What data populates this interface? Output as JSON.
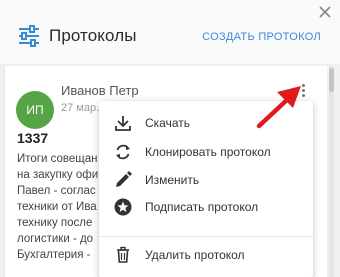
{
  "header": {
    "title": "Протоколы",
    "create_label": "СОЗДАТЬ ПРОТОКОЛ",
    "icons": {
      "menu": "sliders-icon",
      "close": "close-icon"
    }
  },
  "card": {
    "avatar_initials": "ИП",
    "author": "Иванов Петр",
    "date": "27 мар. 2",
    "title": "1337",
    "text_lines": [
      "Итоги совещан",
      "на закупку офи",
      "Павел - соглас",
      "техники от Ива",
      "технику после",
      "логистики - до",
      "Бухгалтерия -"
    ]
  },
  "menu": {
    "items": [
      {
        "label": "Скачать",
        "icon": "download-icon"
      },
      {
        "label": "Клонировать протокол",
        "icon": "clone-icon"
      },
      {
        "label": "Изменить",
        "icon": "edit-icon"
      },
      {
        "label": "Подписать протокол",
        "icon": "sign-icon"
      },
      {
        "label": "Удалить протокол",
        "icon": "delete-icon"
      }
    ]
  },
  "colors": {
    "accent": "#3b8ad8",
    "avatar_bg": "#55a546",
    "arrow": "#e0191e"
  }
}
